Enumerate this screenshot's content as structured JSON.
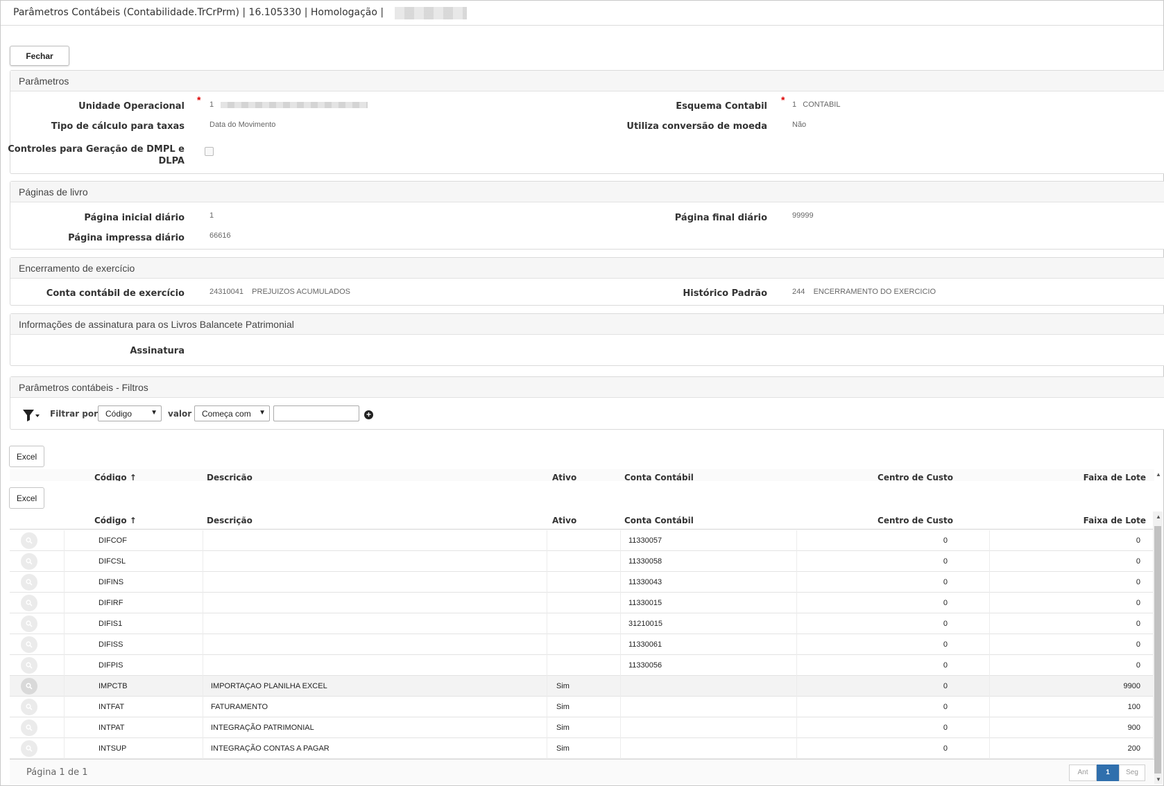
{
  "window": {
    "title": "Parâmetros Contábeis (Contabilidade.TrCrPrm) | 16.105330 | Homologação |"
  },
  "toolbar": {
    "close_label": "Fechar"
  },
  "parametros": {
    "title": "Parâmetros",
    "unidade_label": "Unidade Operacional",
    "unidade_code": "1",
    "esquema_label": "Esquema Contabil",
    "esquema_value": "1   CONTABIL",
    "tipo_calc_label": "Tipo de cálculo para taxas",
    "tipo_calc_value": "Data do Movimento",
    "conversao_label": "Utiliza conversão de moeda",
    "conversao_value": "Não",
    "dmpl_label_1": "Controles para Geração de DMPL e",
    "dmpl_label_2": "DLPA"
  },
  "paginas": {
    "title": "Páginas de livro",
    "inicial_label": "Página inicial diário",
    "inicial_value": "1",
    "final_label": "Página final diário",
    "final_value": "99999",
    "impressa_label": "Página impressa diário",
    "impressa_value": "66616"
  },
  "encerramento": {
    "title": "Encerramento de exercício",
    "conta_label": "Conta contábil de exercício",
    "conta_value": "24310041    PREJUIZOS ACUMULADOS",
    "historico_label": "Histórico Padrão",
    "historico_value": "244    ENCERRAMENTO DO EXERCICIO"
  },
  "assinatura": {
    "title": "Informações de assinatura para os Livros Balancete Patrimonial",
    "label": "Assinatura"
  },
  "filtros": {
    "title": "Parâmetros contábeis - Filtros",
    "filtrar_label": "Filtrar por",
    "filtrar_value": "Código",
    "valor_label": "valor",
    "valor_value": "Começa com"
  },
  "grid": {
    "excel_label": "Excel",
    "columns": [
      "Código",
      "Descrição",
      "Ativo",
      "Conta Contábil",
      "Centro de Custo",
      "Faixa de Lote"
    ],
    "sort_icon": "↑",
    "rows": [
      {
        "codigo": "DIFCOF",
        "descricao": "",
        "ativo": "",
        "conta": "11330057",
        "centro": "0",
        "faixa": "0"
      },
      {
        "codigo": "DIFCSL",
        "descricao": "",
        "ativo": "",
        "conta": "11330058",
        "centro": "0",
        "faixa": "0"
      },
      {
        "codigo": "DIFINS",
        "descricao": "",
        "ativo": "",
        "conta": "11330043",
        "centro": "0",
        "faixa": "0"
      },
      {
        "codigo": "DIFIRF",
        "descricao": "",
        "ativo": "",
        "conta": "11330015",
        "centro": "0",
        "faixa": "0"
      },
      {
        "codigo": "DIFIS1",
        "descricao": "",
        "ativo": "",
        "conta": "31210015",
        "centro": "0",
        "faixa": "0"
      },
      {
        "codigo": "DIFISS",
        "descricao": "",
        "ativo": "",
        "conta": "11330061",
        "centro": "0",
        "faixa": "0"
      },
      {
        "codigo": "DIFPIS",
        "descricao": "",
        "ativo": "",
        "conta": "11330056",
        "centro": "0",
        "faixa": "0"
      },
      {
        "codigo": "IMPCTB",
        "descricao": "IMPORTAÇAO PLANILHA EXCEL",
        "ativo": "Sim",
        "conta": "",
        "centro": "0",
        "faixa": "9900"
      },
      {
        "codigo": "INTFAT",
        "descricao": "FATURAMENTO",
        "ativo": "Sim",
        "conta": "",
        "centro": "0",
        "faixa": "100"
      },
      {
        "codigo": "INTPAT",
        "descricao": "INTEGRAÇÃO PATRIMONIAL",
        "ativo": "Sim",
        "conta": "",
        "centro": "0",
        "faixa": "900"
      },
      {
        "codigo": "INTSUP",
        "descricao": "INTEGRAÇÃO CONTAS A PAGAR",
        "ativo": "Sim",
        "conta": "",
        "centro": "0",
        "faixa": "200"
      }
    ]
  },
  "footer": {
    "page_text": "Página 1 de 1",
    "prev_label": "Ant",
    "current_page": "1",
    "next_label": "Seg"
  },
  "colors": {
    "required": "#dd0000",
    "pager_active": "#2f6fad"
  }
}
